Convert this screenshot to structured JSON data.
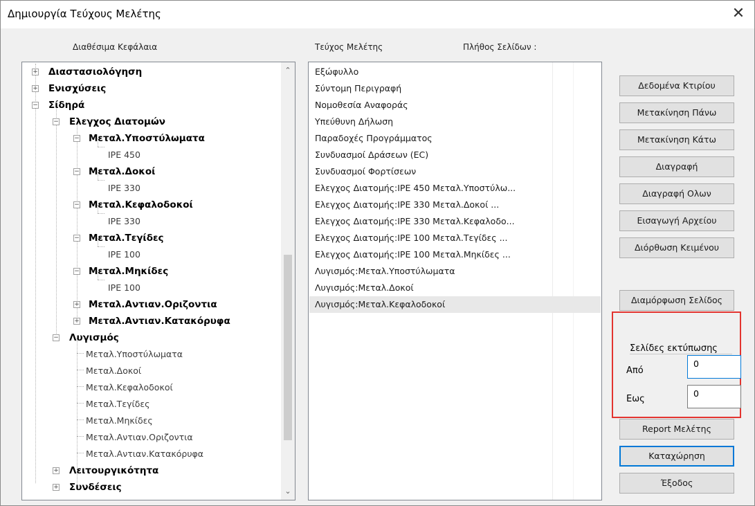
{
  "window": {
    "title": "Δημιουργία Τεύχους Μελέτης",
    "close_glyph": "✕"
  },
  "headers": {
    "available": "Διαθέσιμα Κεφάλαια",
    "study": "Τεύχος Μελέτης",
    "pages": "Πλήθος Σελίδων :"
  },
  "tree": {
    "scroll_up_glyph": "⌃",
    "scroll_down_glyph": "⌄",
    "items": [
      {
        "label": "Διαστασιολόγηση",
        "expander": "+"
      },
      {
        "label": "Ενισχύσεις",
        "expander": "+"
      },
      {
        "label": "Σίδηρά",
        "expander": "−"
      },
      {
        "label": "Ελεγχος Διατομών",
        "expander": "−"
      },
      {
        "label": "Μεταλ.Υποστύλωματα",
        "expander": "−"
      },
      {
        "label": "IPE 450"
      },
      {
        "label": "Μεταλ.Δοκοί",
        "expander": "−"
      },
      {
        "label": "IPE 330"
      },
      {
        "label": "Μεταλ.Κεφαλοδοκοί",
        "expander": "−"
      },
      {
        "label": "IPE 330"
      },
      {
        "label": "Μεταλ.Τεγίδες",
        "expander": "−"
      },
      {
        "label": "IPE 100"
      },
      {
        "label": "Μεταλ.Μηκίδες",
        "expander": "−"
      },
      {
        "label": "IPE 100"
      },
      {
        "label": "Μεταλ.Αντιαν.Οριζοντια",
        "expander": "+"
      },
      {
        "label": "Μεταλ.Αντιαν.Κατακόρυφα",
        "expander": "+"
      },
      {
        "label": "Λυγισμός",
        "expander": "−"
      },
      {
        "label": "Μεταλ.Υποστύλωματα"
      },
      {
        "label": "Μεταλ.Δοκοί"
      },
      {
        "label": "Μεταλ.Κεφαλοδοκοί"
      },
      {
        "label": "Μεταλ.Τεγίδες"
      },
      {
        "label": "Μεταλ.Μηκίδες"
      },
      {
        "label": "Μεταλ.Αντιαν.Οριζοντια"
      },
      {
        "label": "Μεταλ.Αντιαν.Κατακόρυφα"
      },
      {
        "label": "Λειτουργικότητα",
        "expander": "+"
      },
      {
        "label": "Συνδέσεις",
        "expander": "+"
      }
    ]
  },
  "study_list": [
    "Εξώφυλλο",
    "Σύντομη Περιγραφή",
    "Νομοθεσία Αναφοράς",
    "Υπεύθυνη Δήλωση",
    "Παραδοχές Προγράμματος",
    "Συνδυασμοί Δράσεων (EC)",
    "Συνδυασμοί Φορτίσεων",
    "Ελεγχος Διατομής:IPE 450 Μεταλ.Υποστύλω...",
    "Ελεγχος Διατομής:IPE 330 Μεταλ.Δοκοί        ...",
    "Ελεγχος Διατομής:IPE 330 Μεταλ.Κεφαλοδο...",
    "Ελεγχος Διατομής:IPE 100 Μεταλ.Τεγίδες      ...",
    "Ελεγχος Διατομής:IPE 100 Μεταλ.Μηκίδες      ...",
    "Λυγισμός:Μεταλ.Υποστύλωματα",
    "Λυγισμός:Μεταλ.Δοκοί",
    "Λυγισμός:Μεταλ.Κεφαλοδοκοί"
  ],
  "selected_index": 14,
  "buttons": {
    "owner_data": "Δεδομένα Κτιρίου",
    "move_up": "Μετακίνηση Πάνω",
    "move_down": "Μετακίνηση Κάτω",
    "delete": "Διαγραφή",
    "delete_all": "Διαγραφή Ολων",
    "import_file": "Εισαγωγή Αρχείου",
    "edit_text": "Διόρθωση Κειμένου",
    "page_setup": "Διαμόρφωση Σελίδος",
    "report": "Report Μελέτης",
    "save": "Καταχώρηση",
    "exit": "Έξοδος"
  },
  "print_pages": {
    "title": "Σελίδες εκτύπωσης",
    "from_label": "Από",
    "to_label": "Εως",
    "from_value": "0",
    "to_value": "0"
  },
  "colors": {
    "highlight_box": "#e3342f",
    "default_button_border": "#0078d7"
  }
}
